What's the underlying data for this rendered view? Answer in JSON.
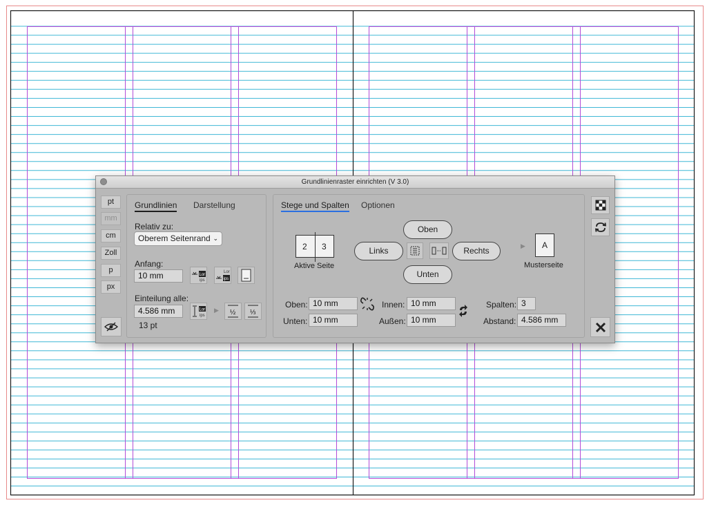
{
  "dialog": {
    "title": "Grundlinienraster einrichten (V 3.0)",
    "units": [
      "pt",
      "mm",
      "cm",
      "Zoll",
      "p",
      "px"
    ],
    "units_disabled": "mm",
    "left_tabs": {
      "grundlinien": "Grundlinien",
      "darstellung": "Darstellung"
    },
    "relativ_label": "Relativ zu:",
    "relativ_value": "Oberem Seitenrand",
    "anfang_label": "Anfang:",
    "anfang_value": "10 mm",
    "einteilung_label": "Einteilung alle:",
    "einteilung_value": "4.586 mm",
    "einteilung_pt": "13 pt",
    "right_tabs": {
      "stege": "Stege und Spalten",
      "optionen": "Optionen"
    },
    "page_left_number": "2",
    "page_right_number": "3",
    "aktive_seite": "Aktive Seite",
    "btn_oben": "Oben",
    "btn_unten": "Unten",
    "btn_links": "Links",
    "btn_rechts": "Rechts",
    "master_letter": "A",
    "musterseite": "Musterseite",
    "oben_label": "Oben:",
    "oben_value": "10 mm",
    "unten_label": "Unten:",
    "unten_value": "10 mm",
    "innen_label": "Innen:",
    "innen_value": "10 mm",
    "aussen_label": "Außen:",
    "aussen_value": "10 mm",
    "spalten_label": "Spalten:",
    "spalten_value": "3",
    "abstand_label": "Abstand:",
    "abstand_value": "4.586 mm",
    "icon_text_top": "Lor",
    "icon_text_bottom": "ips",
    "icon_fraction_half": "½",
    "icon_fraction_third": "⅓"
  },
  "colors": {
    "baseline": "#3fb7d6",
    "column_guide": "#b24cd8",
    "margin_guide": "#e88a8a",
    "page_border": "#1a1a1a"
  }
}
